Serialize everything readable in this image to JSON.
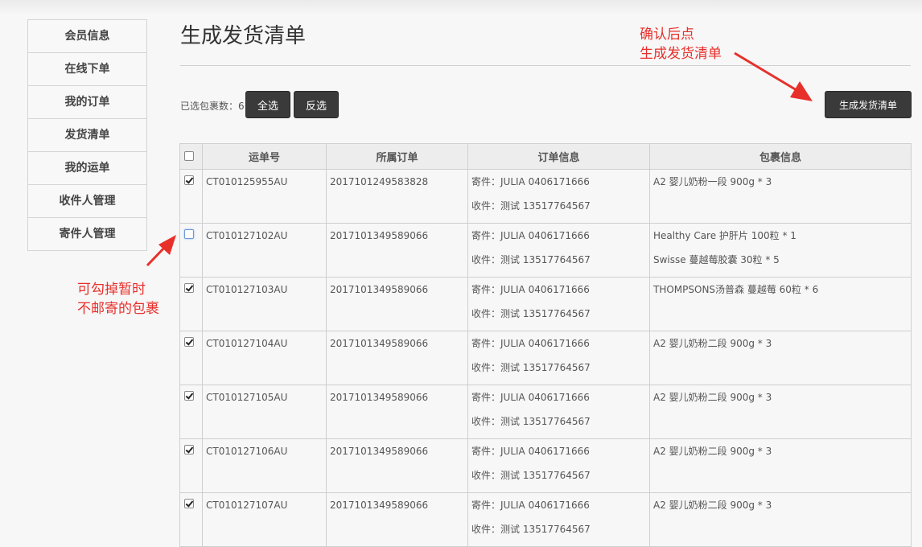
{
  "sidebar": {
    "items": [
      {
        "label": "会员信息"
      },
      {
        "label": "在线下单"
      },
      {
        "label": "我的订单"
      },
      {
        "label": "发货清单"
      },
      {
        "label": "我的运单"
      },
      {
        "label": "收件人管理"
      },
      {
        "label": "寄件人管理"
      }
    ]
  },
  "page": {
    "title": "生成发货清单"
  },
  "toolbar": {
    "selected_label": "已选包裹数：",
    "selected_count": "6",
    "select_all_label": "全选",
    "invert_label": "反选",
    "generate_label": "生成发货清单"
  },
  "table": {
    "headers": [
      "运单号",
      "所属订单",
      "订单信息",
      "包裹信息"
    ],
    "header_checked": false,
    "rows": [
      {
        "checked": true,
        "tracking": "CT010125955AU",
        "order": "2017101249583828",
        "sender": "寄件：JULIA 0406171666",
        "receiver": "收件：测试 13517764567",
        "items": [
          "A2 婴儿奶粉一段 900g * 3"
        ]
      },
      {
        "checked": false,
        "tracking": "CT010127102AU",
        "order": "2017101349589066",
        "sender": "寄件：JULIA 0406171666",
        "receiver": "收件：测试 13517764567",
        "items": [
          "Healthy Care 护肝片 100粒 * 1",
          "Swisse 蔓越莓胶囊 30粒 * 5"
        ]
      },
      {
        "checked": true,
        "tracking": "CT010127103AU",
        "order": "2017101349589066",
        "sender": "寄件：JULIA 0406171666",
        "receiver": "收件：测试 13517764567",
        "items": [
          "THOMPSONS汤普森 蔓越莓 60粒 * 6"
        ]
      },
      {
        "checked": true,
        "tracking": "CT010127104AU",
        "order": "2017101349589066",
        "sender": "寄件：JULIA 0406171666",
        "receiver": "收件：测试 13517764567",
        "items": [
          "A2 婴儿奶粉二段 900g * 3"
        ]
      },
      {
        "checked": true,
        "tracking": "CT010127105AU",
        "order": "2017101349589066",
        "sender": "寄件：JULIA 0406171666",
        "receiver": "收件：测试 13517764567",
        "items": [
          "A2 婴儿奶粉二段 900g * 3"
        ]
      },
      {
        "checked": true,
        "tracking": "CT010127106AU",
        "order": "2017101349589066",
        "sender": "寄件：JULIA 0406171666",
        "receiver": "收件：测试 13517764567",
        "items": [
          "A2 婴儿奶粉二段 900g * 3"
        ]
      },
      {
        "checked": true,
        "tracking": "CT010127107AU",
        "order": "2017101349589066",
        "sender": "寄件：JULIA 0406171666",
        "receiver": "收件：测试 13517764567",
        "items": [
          "A2 婴儿奶粉二段 900g * 3"
        ]
      }
    ]
  },
  "annotations": {
    "confirm_line1": "确认后点",
    "confirm_line2": "生成发货清单",
    "uncheck_line1": "可勾掉暂时",
    "uncheck_line2": "不邮寄的包裹",
    "color": "#e8302b"
  }
}
